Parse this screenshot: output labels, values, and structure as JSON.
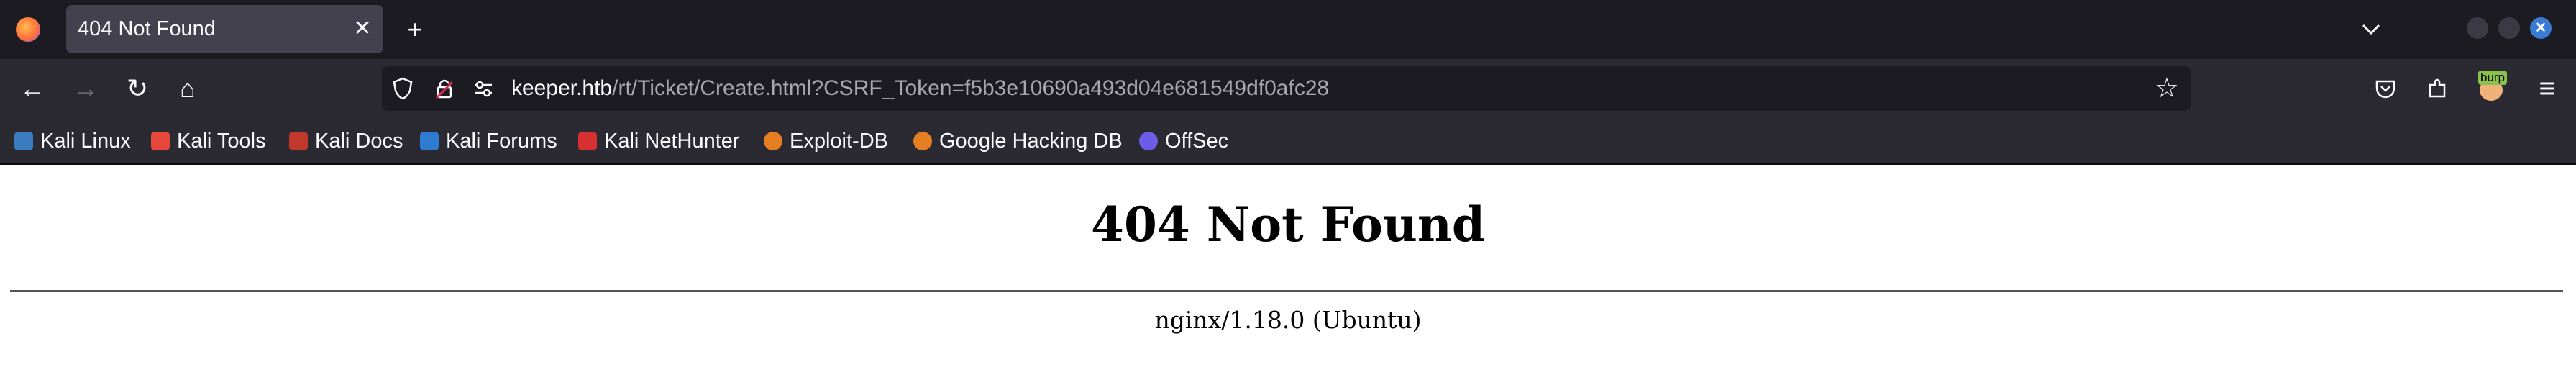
{
  "tab": {
    "title": "404 Not Found",
    "close_label": "✕"
  },
  "toolbar": {
    "new_tab": "+",
    "list_all_tabs": "⌄"
  },
  "navbar": {
    "back": "←",
    "forward": "→",
    "reload": "↻",
    "home": "⌂",
    "url_host": "keeper.htb",
    "url_path": "/rt/Ticket/Create.html?CSRF_Token=f5b3e10690a493d04e681549df0afc28",
    "bookmark_star": "☆",
    "menu": "≡",
    "burp_badge": "burp"
  },
  "bookmarks": [
    {
      "label": "Kali Linux",
      "color": "#3b7bbf"
    },
    {
      "label": "Kali Tools",
      "color": "#e8483b"
    },
    {
      "label": "Kali Docs",
      "color": "#c0392b"
    },
    {
      "label": "Kali Forums",
      "color": "#2d7ccf"
    },
    {
      "label": "Kali NetHunter",
      "color": "#d63031"
    },
    {
      "label": "Exploit-DB",
      "color": "#e67e22"
    },
    {
      "label": "Google Hacking DB",
      "color": "#e67e22"
    },
    {
      "label": "OffSec",
      "color": "#6c5ce7"
    }
  ],
  "page": {
    "heading": "404 Not Found",
    "server": "nginx/1.18.0 (Ubuntu)"
  },
  "colors": {
    "accent_close": "#3a7bd5",
    "tab_bar": "#1c1b22",
    "nav_bar": "#2b2a33"
  }
}
